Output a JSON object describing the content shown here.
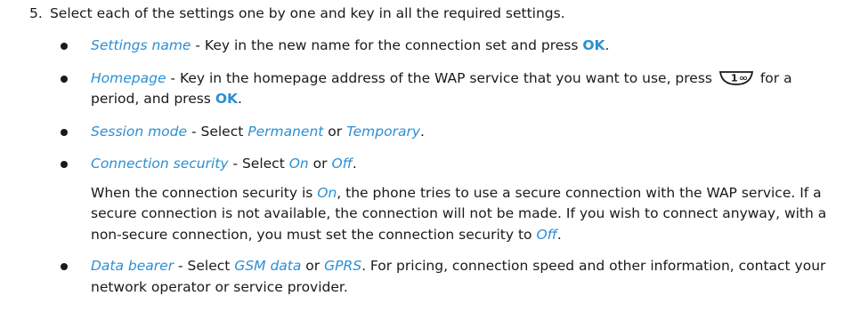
{
  "step": {
    "number": "5.",
    "text": "Select each of the settings one by one and key in all the required settings."
  },
  "items": [
    {
      "term": "Settings name",
      "sep": " - ",
      "text1": "Key in the new name for the connection set and press ",
      "ok": "OK",
      "end": "."
    },
    {
      "term": "Homepage",
      "sep": " - ",
      "text1": "Key in the homepage address of the WAP service that you want to use, press ",
      "key_icon": "key-1-icon",
      "key_label": "1",
      "text2": " for a period, and press ",
      "ok": "OK",
      "end": "."
    },
    {
      "term": "Session mode",
      "sep": " - Select ",
      "opt1": "Permanent",
      "or": " or ",
      "opt2": "Temporary",
      "end": "."
    },
    {
      "term": "Connection security",
      "sep": " - Select ",
      "opt1": "On",
      "or": " or ",
      "opt2": "Off",
      "end": "."
    },
    {
      "term": "Data bearer",
      "sep": " - Select ",
      "opt1": "GSM data",
      "or": " or ",
      "opt2": "GPRS",
      "text": ". For pricing, connection speed and other information, contact your network operator or service provider."
    }
  ],
  "note": {
    "t1": "When the connection security is ",
    "v1": "On",
    "t2": ", the phone tries to use a secure connection with the WAP service. If a secure connection is not available, the connection will not be made. If you wish to connect anyway, with a non-secure connection, you must set the connection security to ",
    "v2": "Off",
    "t3": "."
  },
  "colors": {
    "accent": "#2b8fd4",
    "text": "#1a1a1a"
  }
}
